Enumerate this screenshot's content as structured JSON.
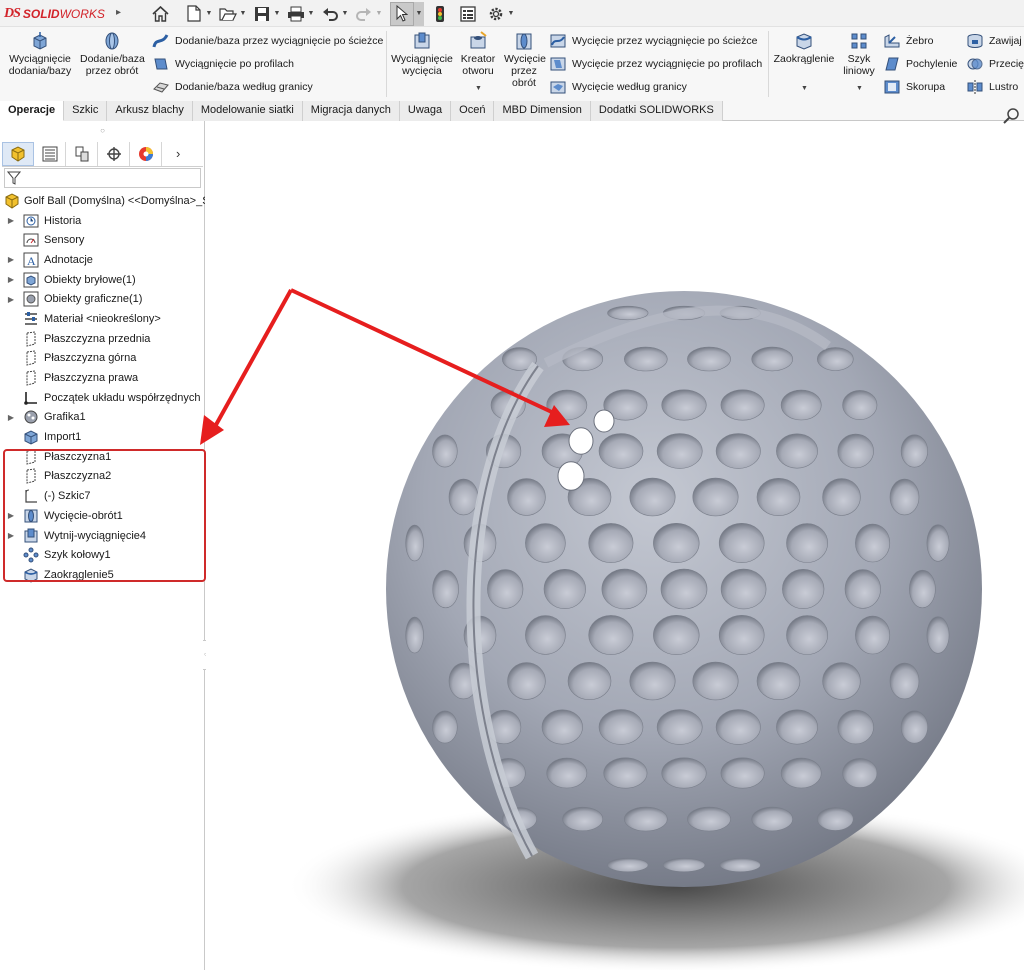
{
  "app": {
    "logo_ds": "DS",
    "logo_name_bold": "SOLID",
    "logo_name_regular": "WORKS"
  },
  "quick_access": [
    "home-icon",
    "new-document-icon",
    "open-icon",
    "save-icon",
    "print-icon",
    "undo-icon",
    "redo-icon",
    "select-icon",
    "rebuild-icon",
    "file-properties-icon",
    "options-icon"
  ],
  "command_manager": {
    "extruded_boss": "Wyciągnięcie dodania/bazy",
    "revolved_boss": "Dodanie/baza przez obrót",
    "swept_boss": "Dodanie/baza przez wyciągnięcie po ścieżce",
    "lofted_boss": "Wyciągnięcie po profilach",
    "boundary_boss": "Dodanie/baza według granicy",
    "extruded_cut": "Wyciągnięcie wycięcia",
    "hole_wizard": "Kreator otworu",
    "revolved_cut": "Wycięcie przez obrót",
    "swept_cut": "Wycięcie przez wyciągnięcie po ścieżce",
    "lofted_cut": "Wycięcie przez wyciągnięcie po profilach",
    "boundary_cut": "Wycięcie według granicy",
    "fillet": "Zaokrąglenie",
    "linear_pattern": "Szyk liniowy",
    "rib": "Żebro",
    "draft": "Pochylenie",
    "shell": "Skorupa",
    "wrap": "Zawijaj",
    "intersect": "Przecię",
    "mirror": "Lustro"
  },
  "tabs": [
    "Operacje",
    "Szkic",
    "Arkusz blachy",
    "Modelowanie siatki",
    "Migracja danych",
    "Uwaga",
    "Oceń",
    "MBD Dimension",
    "Dodatki SOLIDWORKS"
  ],
  "active_tab": "Operacje",
  "feature_tree": {
    "root": "Golf Ball (Domyślna) <<Domyślna>_S",
    "items": [
      {
        "label": "Historia",
        "icon": "history-icon",
        "expandable": true
      },
      {
        "label": "Sensory",
        "icon": "sensors-icon",
        "expandable": false
      },
      {
        "label": "Adnotacje",
        "icon": "annotations-icon",
        "expandable": true
      },
      {
        "label": "Obiekty bryłowe(1)",
        "icon": "solid-bodies-icon",
        "expandable": true
      },
      {
        "label": "Obiekty graficzne(1)",
        "icon": "graphics-bodies-icon",
        "expandable": true
      },
      {
        "label": "Materiał <nieokreślony>",
        "icon": "material-icon",
        "expandable": false
      },
      {
        "label": "Płaszczyzna przednia",
        "icon": "plane-icon",
        "expandable": false
      },
      {
        "label": "Płaszczyzna górna",
        "icon": "plane-icon",
        "expandable": false
      },
      {
        "label": "Płaszczyzna prawa",
        "icon": "plane-icon",
        "expandable": false
      },
      {
        "label": "Początek układu współrzędnych",
        "icon": "origin-icon",
        "expandable": false
      },
      {
        "label": "Grafika1",
        "icon": "graphics-icon",
        "expandable": true
      },
      {
        "label": "Import1",
        "icon": "import-icon",
        "expandable": false
      },
      {
        "label": "Płaszczyzna1",
        "icon": "plane-icon",
        "expandable": false
      },
      {
        "label": "Płaszczyzna2",
        "icon": "plane-icon",
        "expandable": false
      },
      {
        "label": "(-) Szkic7",
        "icon": "sketch-icon",
        "expandable": false
      },
      {
        "label": "Wycięcie-obrót1",
        "icon": "revolved-cut-icon",
        "expandable": true
      },
      {
        "label": "Wytnij-wyciągnięcie4",
        "icon": "extruded-cut-icon",
        "expandable": true
      },
      {
        "label": "Szyk kołowy1",
        "icon": "circular-pattern-icon",
        "expandable": false
      },
      {
        "label": "Zaokrąglenie5",
        "icon": "fillet-icon",
        "expandable": false
      }
    ]
  },
  "colors": {
    "brand_red": "#d2232a",
    "annotation_red": "#e61e1e",
    "model_gray": "#9aa0ad",
    "highlight_border": "#cf2a2a"
  }
}
